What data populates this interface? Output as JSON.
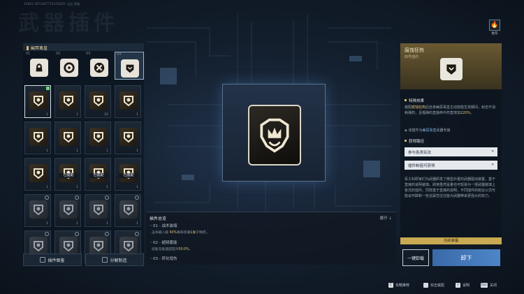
{
  "top_id": "35883 2871067774378429",
  "top_label": "出品 保留",
  "bg_title": "武器插件",
  "left": {
    "header": "幽冥毒皇",
    "slots": [
      {
        "num": "01",
        "icon": "ghost-bust-icon"
      },
      {
        "num": "02",
        "icon": "swirl-icon"
      },
      {
        "num": "03",
        "icon": "cross-blades-icon"
      },
      {
        "num": "04",
        "icon": "crest-icon"
      }
    ],
    "cards": [
      {
        "icon": "crest-icon",
        "count": "1",
        "level": "",
        "equipped": "",
        "style": "gold",
        "selected": true
      },
      {
        "icon": "skull-cap-icon",
        "count": "1",
        "level": "",
        "equipped": "",
        "style": "gold"
      },
      {
        "icon": "burst-icon",
        "count": "22",
        "level": "",
        "equipped": "",
        "style": "gold"
      },
      {
        "icon": "dragon-icon",
        "count": "1",
        "level": "",
        "equipped": "",
        "style": "gold"
      },
      {
        "icon": "witch-icon",
        "count": "1",
        "level": "",
        "equipped": "",
        "style": "gold"
      },
      {
        "icon": "mask-icon",
        "count": "1",
        "level": "",
        "equipped": "",
        "style": "gold"
      },
      {
        "icon": "flame-hand-icon",
        "count": "1",
        "level": "",
        "equipped": "",
        "style": "gold"
      },
      {
        "icon": "flame-icon",
        "count": "1",
        "level": "",
        "equipped": "",
        "style": "gold"
      },
      {
        "icon": "book-icon",
        "count": "1",
        "level": "",
        "equipped": "",
        "style": "gold"
      },
      {
        "icon": "swirl-icon",
        "count": "1",
        "level": "",
        "equipped": "已装配",
        "style": "gold"
      },
      {
        "icon": "ghost-bust-icon",
        "count": "1",
        "level": "",
        "equipped": "已装配",
        "style": "gold"
      },
      {
        "icon": "cross-blades-icon",
        "count": "1",
        "level": "",
        "equipped": "已装配",
        "style": "gold"
      },
      {
        "icon": "bolt-icon",
        "count": "1",
        "level": "",
        "equipped": "",
        "style": "grey"
      },
      {
        "icon": "star-icon",
        "count": "1",
        "level": "",
        "equipped": "",
        "style": "grey"
      },
      {
        "icon": "triangle-icon",
        "count": "1",
        "level": "",
        "equipped": "",
        "style": "grey"
      },
      {
        "icon": "shield-icon",
        "count": "1",
        "level": "",
        "equipped": "",
        "style": "grey"
      },
      {
        "icon": "bolt-icon",
        "count": "",
        "level": "",
        "equipped": "",
        "style": "grey"
      },
      {
        "icon": "star-icon",
        "count": "",
        "level": "",
        "equipped": "",
        "style": "grey"
      },
      {
        "icon": "triangle-icon",
        "count": "",
        "level": "",
        "equipped": "",
        "style": "grey"
      },
      {
        "icon": "shield-icon",
        "count": "",
        "level": "",
        "equipped": "",
        "style": "grey"
      }
    ],
    "btn_catalog": "插件图鉴",
    "btn_craft": "分解制造",
    "btn_catalog_key": "",
    "btn_craft_key": ""
  },
  "summary": {
    "title": "插件总览",
    "expand": "展开",
    "lines": [
      {
        "label": "01 - 战术装填",
        "sub_pre": "击杀输入敌  ",
        "sub_hl": "40%",
        "sub_post": "概率装填",
        "sub_hl2": "1发",
        "sub_end": "子弹药。"
      },
      {
        "label": "02 - 超频蓄能",
        "sub_pre": "技能充能速度提升",
        "sub_hl": "50.0%",
        "sub_post": "。",
        "sub_hl2": "",
        "sub_end": ""
      },
      {
        "label": "03 - 转化增伤",
        "sub_pre": "",
        "sub_hl": "",
        "sub_post": "",
        "sub_hl2": "",
        "sub_end": ""
      }
    ]
  },
  "right": {
    "name": "腐蚀狂热",
    "type": "四号插件",
    "special_title": "特殊效果",
    "special_pre": "装配",
    "special_hl": "腐蚀狂热",
    "special_mid": "后自身幽冥毒皇主动技能生效期间，射击不消耗弹药，且榴弹的直接命中伤害增加",
    "special_val": "220%",
    "special_end": "。",
    "exclusive_pre": "该插件为",
    "exclusive_hl": "幽冥毒皇",
    "exclusive_post": "武器专属",
    "obtain_title": "获得路径",
    "obtain_btn1": "参与各类玩法",
    "obtain_btn2": "插件制造可获得",
    "lore": "军工科研家们为武器研发了微型外置的武器驱动装置。基于直接的说明装填，即使虽然是量也可轻易为一把武器装填上各式的插件。同样基于直接的说明，不同插件的组合公式可能会开辟新一些这属性往往能为武器带来更强大的效力。",
    "current": "当前装备"
  },
  "buttons": {
    "one_click": "一键卸载",
    "unload": "卸下"
  },
  "recommend": "推荐",
  "footer": [
    {
      "key": "C",
      "label": "攻略推荐"
    },
    {
      "key": "",
      "label": "双击装配"
    },
    {
      "key": "I",
      "label": "说明"
    },
    {
      "key": "Esc",
      "label": "关闭"
    }
  ],
  "colors": {
    "accent": "#d6b46a",
    "primary_button": "#4d86c8",
    "highlight": "#e3c46a"
  }
}
